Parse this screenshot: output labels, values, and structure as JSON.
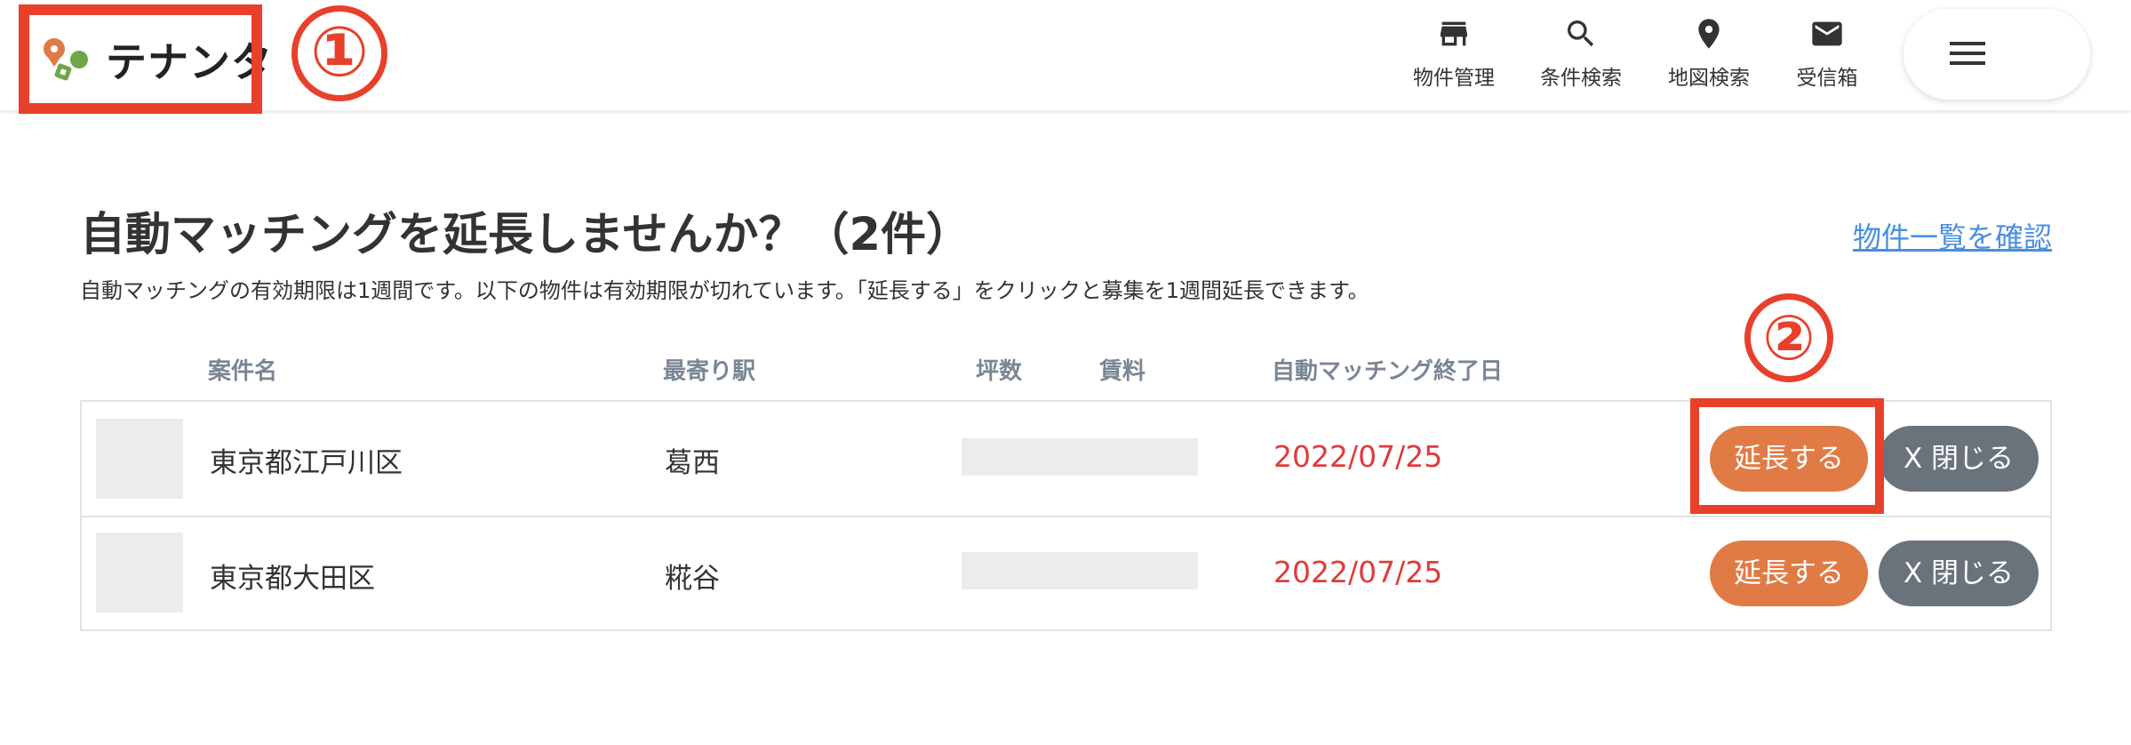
{
  "header": {
    "logo_text": "テナンタ",
    "nav": [
      {
        "label": "物件管理",
        "icon": "store-icon"
      },
      {
        "label": "条件検索",
        "icon": "search-icon"
      },
      {
        "label": "地図検索",
        "icon": "map-pin-icon"
      },
      {
        "label": "受信箱",
        "icon": "mail-icon"
      }
    ],
    "menu_icon": "hamburger-icon"
  },
  "annotations": {
    "marker_1": "①",
    "marker_2": "②",
    "accent_color": "#e8402a"
  },
  "main": {
    "title": "自動マッチングを延長しませんか？（2件）",
    "list_link": "物件一覧を確認",
    "description": "自動マッチングの有効期限は1週間です。以下の物件は有効期限が切れています。「延長する」をクリックと募集を1週間延長できます。",
    "columns": {
      "name": "案件名",
      "station": "最寄り駅",
      "area": "坪数",
      "rent": "賃料",
      "end_date": "自動マッチング終了日"
    },
    "rows": [
      {
        "name": "東京都江戸川区",
        "station": "葛西",
        "end_date": "2022/07/25",
        "extend_label": "延長する",
        "close_label": "X 閉じる"
      },
      {
        "name": "東京都大田区",
        "station": "糀谷",
        "end_date": "2022/07/25",
        "extend_label": "延長する",
        "close_label": "X 閉じる"
      }
    ]
  },
  "colors": {
    "extend_button": "#e07b45",
    "close_button": "#6a727c",
    "date": "#e03a3a",
    "link": "#4a8fe0"
  }
}
